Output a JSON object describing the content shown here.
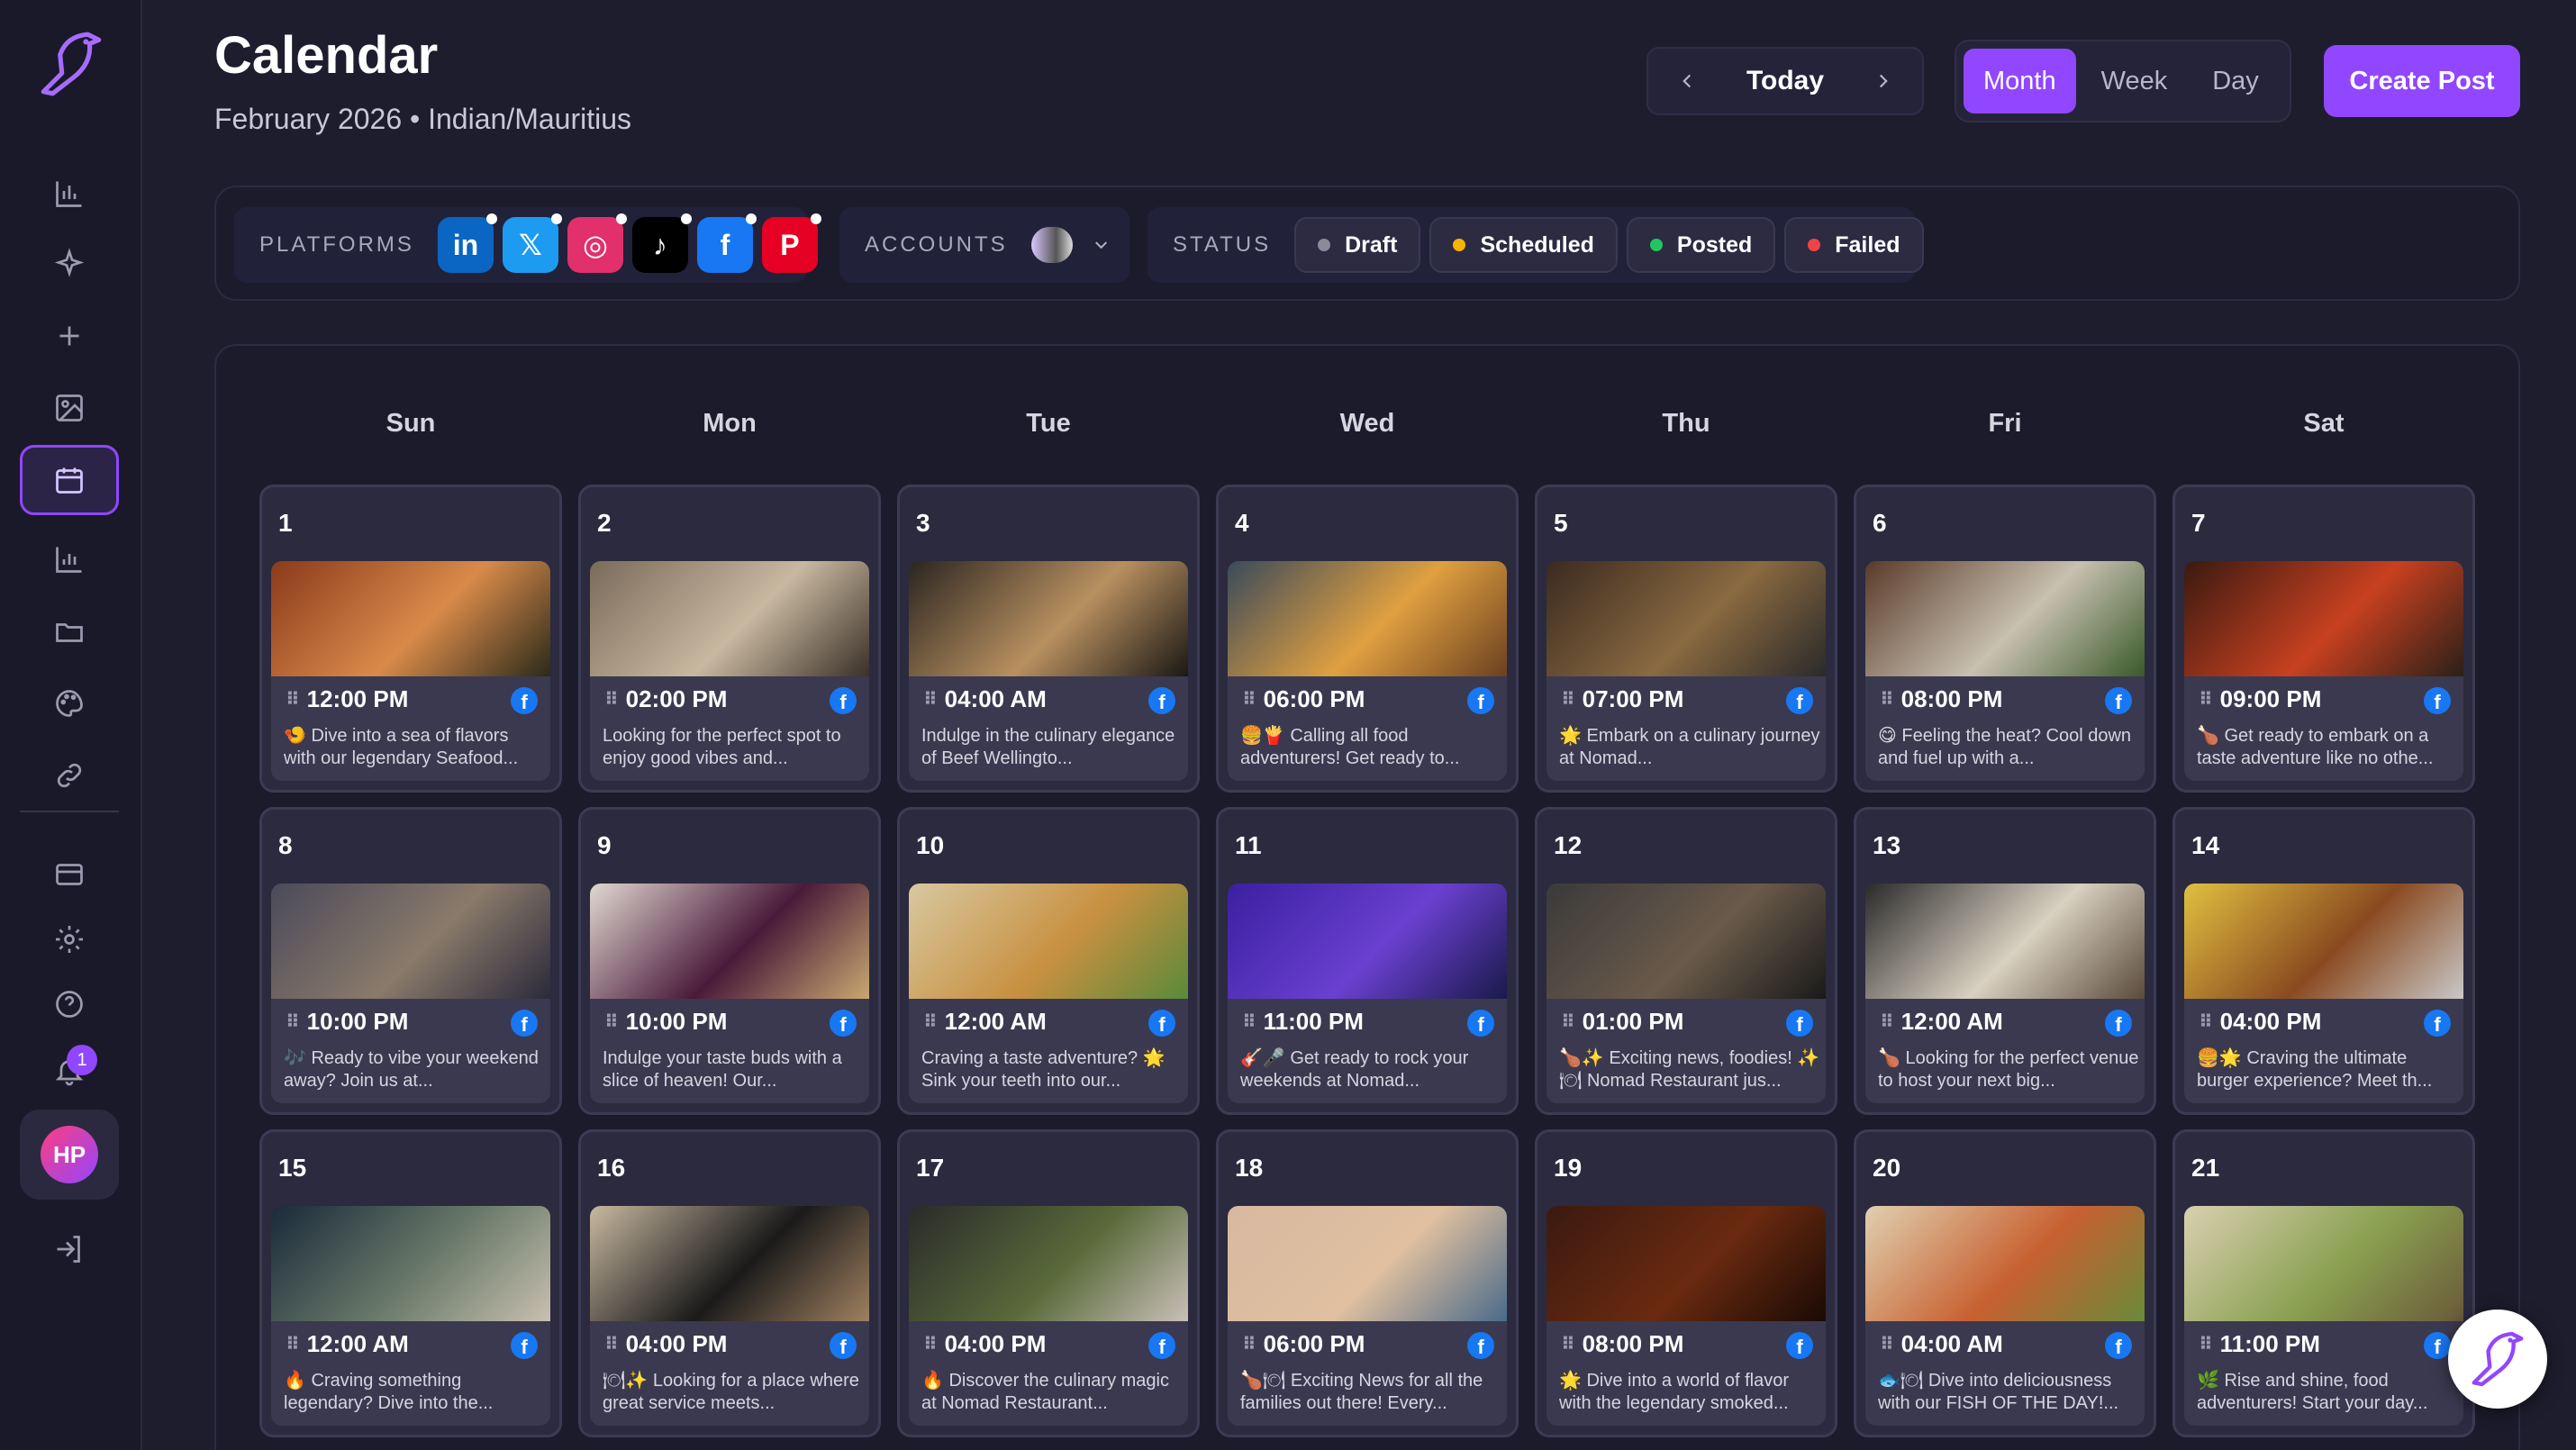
{
  "header": {
    "title": "Calendar",
    "subtitle": "February 2026 • Indian/Mauritius"
  },
  "nav": {
    "today": "Today",
    "views": [
      "Month",
      "Week",
      "Day"
    ],
    "active_view": "Month",
    "create": "Create Post"
  },
  "filters": {
    "platforms_label": "PLATFORMS",
    "platforms": [
      {
        "name": "linkedin-icon",
        "glyph": "in",
        "color": "#0a66c2"
      },
      {
        "name": "x-icon",
        "glyph": "𝕏",
        "color": "#1d9bf0"
      },
      {
        "name": "instagram-icon",
        "glyph": "◎",
        "color": "#e1306c"
      },
      {
        "name": "tiktok-icon",
        "glyph": "♪",
        "color": "#000000"
      },
      {
        "name": "facebook-icon",
        "glyph": "f",
        "color": "#1877f2"
      },
      {
        "name": "pinterest-icon",
        "glyph": "P",
        "color": "#e60023"
      }
    ],
    "accounts_label": "ACCOUNTS",
    "status_label": "STATUS",
    "statuses": [
      {
        "label": "Draft",
        "color": "#8a8a99"
      },
      {
        "label": "Scheduled",
        "color": "#f5b400"
      },
      {
        "label": "Posted",
        "color": "#22c55e"
      },
      {
        "label": "Failed",
        "color": "#ef4444"
      }
    ]
  },
  "sidebar": {
    "notification_count": "1",
    "avatar_initials": "HP"
  },
  "calendar": {
    "weekdays": [
      "Sun",
      "Mon",
      "Tue",
      "Wed",
      "Thu",
      "Fri",
      "Sat"
    ],
    "days": [
      {
        "day": "1",
        "time": "12:00 PM",
        "caption": "🍤 Dive into a sea of flavors with our legendary Seafood...",
        "thumb": [
          "#8a3a1a",
          "#d98a4a",
          "#2a2a1a"
        ]
      },
      {
        "day": "2",
        "time": "02:00 PM",
        "caption": "Looking for the perfect spot to enjoy good vibes and...",
        "thumb": [
          "#7a6a5a",
          "#c8b8a0",
          "#3a3028"
        ]
      },
      {
        "day": "3",
        "time": "04:00 AM",
        "caption": "Indulge in the culinary elegance of Beef Wellingto...",
        "thumb": [
          "#2a2520",
          "#b89060",
          "#1a1815"
        ]
      },
      {
        "day": "4",
        "time": "06:00 PM",
        "caption": "🍔🍟 Calling all food adventurers! Get ready to...",
        "thumb": [
          "#3a4a5a",
          "#e0a040",
          "#6a4020"
        ]
      },
      {
        "day": "5",
        "time": "07:00 PM",
        "caption": "🌟 Embark on a culinary journey at Nomad...",
        "thumb": [
          "#3a2a20",
          "#8a6a40",
          "#2a2a2a"
        ]
      },
      {
        "day": "6",
        "time": "08:00 PM",
        "caption": "😋 Feeling the heat? Cool down and fuel up with a...",
        "thumb": [
          "#5a3a2a",
          "#c8c0b0",
          "#3a5a2a"
        ]
      },
      {
        "day": "7",
        "time": "09:00 PM",
        "caption": "🍗 Get ready to embark on a taste adventure like no othe...",
        "thumb": [
          "#3a1a10",
          "#c84020",
          "#2a2018"
        ]
      },
      {
        "day": "8",
        "time": "10:00 PM",
        "caption": "🎶 Ready to vibe your weekend away? Join us at...",
        "thumb": [
          "#4a4a5a",
          "#8a7a6a",
          "#2a2a3a"
        ]
      },
      {
        "day": "9",
        "time": "10:00 PM",
        "caption": "Indulge your taste buds with a slice of heaven! Our...",
        "thumb": [
          "#e0d8d0",
          "#4a1a3a",
          "#c8a870"
        ]
      },
      {
        "day": "10",
        "time": "12:00 AM",
        "caption": "Craving a taste adventure? 🌟 Sink your teeth into our...",
        "thumb": [
          "#d8c8a0",
          "#c89040",
          "#5a8a3a"
        ]
      },
      {
        "day": "11",
        "time": "11:00 PM",
        "caption": "🎸🎤 Get ready to rock your weekends at Nomad...",
        "thumb": [
          "#3a20a0",
          "#6a40d0",
          "#1a1a4a"
        ]
      },
      {
        "day": "12",
        "time": "01:00 PM",
        "caption": "🍗✨ Exciting news, foodies! ✨🍽 Nomad Restaurant jus...",
        "thumb": [
          "#3a3a3a",
          "#6a5a4a",
          "#1a1a1a"
        ]
      },
      {
        "day": "13",
        "time": "12:00 AM",
        "caption": "🍗 Looking for the perfect venue to host your next big...",
        "thumb": [
          "#2a2a2a",
          "#d8d0c0",
          "#5a4a3a"
        ]
      },
      {
        "day": "14",
        "time": "04:00 PM",
        "caption": "🍔🌟 Craving the ultimate burger experience? Meet th...",
        "thumb": [
          "#e0c040",
          "#8a4a20",
          "#c8c8c8"
        ]
      },
      {
        "day": "15",
        "time": "12:00 AM",
        "caption": "🔥 Craving something legendary? Dive into the...",
        "thumb": [
          "#1a2a3a",
          "#6a7a6a",
          "#c8c0b0"
        ]
      },
      {
        "day": "16",
        "time": "04:00 PM",
        "caption": "🍽✨ Looking for a place where great service meets...",
        "thumb": [
          "#c8b8a0",
          "#1a1a1a",
          "#a08060"
        ]
      },
      {
        "day": "17",
        "time": "04:00 PM",
        "caption": "🔥 Discover the culinary magic at Nomad Restaurant...",
        "thumb": [
          "#2a2a2a",
          "#5a6a3a",
          "#c8c0b8"
        ]
      },
      {
        "day": "18",
        "time": "06:00 PM",
        "caption": "🍗🍽 Exciting News for all the families out there! Every...",
        "thumb": [
          "#d8b8a0",
          "#e0c0a0",
          "#4a6a8a"
        ]
      },
      {
        "day": "19",
        "time": "08:00 PM",
        "caption": "🌟 Dive into a world of flavor with the legendary smoked...",
        "thumb": [
          "#3a1a10",
          "#6a2a10",
          "#1a0a05"
        ]
      },
      {
        "day": "20",
        "time": "04:00 AM",
        "caption": "🐟🍽 Dive into deliciousness with our FISH OF THE DAY!...",
        "thumb": [
          "#e0d0b0",
          "#c86030",
          "#6a8a3a"
        ]
      },
      {
        "day": "21",
        "time": "11:00 PM",
        "caption": "🌿 Rise and shine, food adventurers! Start your day...",
        "thumb": [
          "#d8d0b0",
          "#8aa050",
          "#6a5a3a"
        ]
      }
    ]
  }
}
